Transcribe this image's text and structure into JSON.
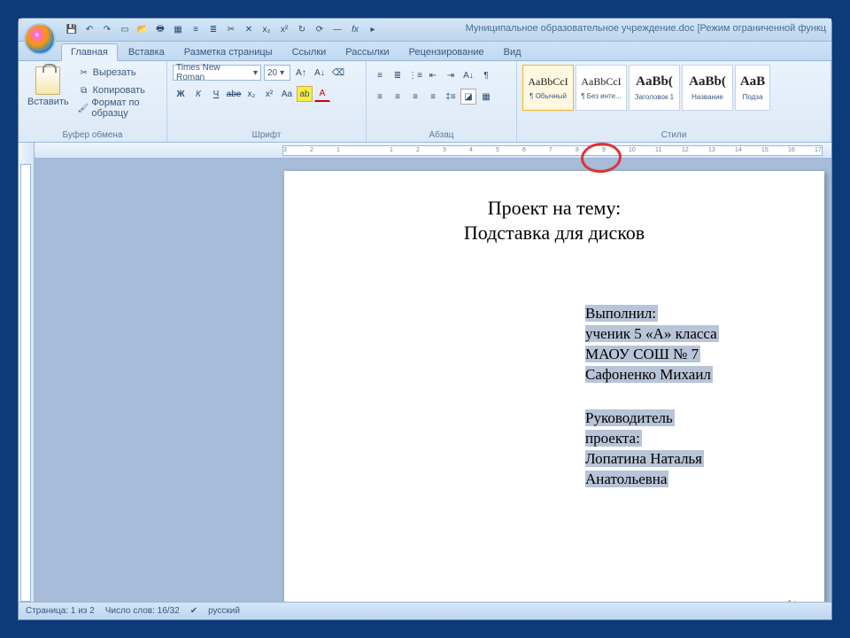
{
  "window": {
    "title": "Муниципальное образовательное учреждение.doc [Режим ограниченной функц"
  },
  "qat": [
    "save",
    "undo",
    "redo",
    "new",
    "open",
    "print",
    "table",
    "align",
    "list",
    "cut",
    "close",
    "sub",
    "sup",
    "redoA",
    "refresh",
    "minus",
    "fx",
    "play"
  ],
  "tabs": [
    {
      "label": "Главная",
      "active": true
    },
    {
      "label": "Вставка"
    },
    {
      "label": "Разметка страницы"
    },
    {
      "label": "Ссылки"
    },
    {
      "label": "Рассылки"
    },
    {
      "label": "Рецензирование"
    },
    {
      "label": "Вид"
    }
  ],
  "ribbon": {
    "clipboard": {
      "paste": "Вставить",
      "cut": "Вырезать",
      "copy": "Копировать",
      "format": "Формат по образцу",
      "title": "Буфер обмена"
    },
    "font": {
      "name": "Times New Roman",
      "size": "20",
      "title": "Шрифт",
      "btns": [
        "Ж",
        "К",
        "Ч",
        "abe",
        "x₂",
        "x²",
        "Aa",
        "ab",
        "A",
        "A"
      ]
    },
    "paragraph": {
      "title": "Абзац"
    },
    "styles": {
      "title": "Стили",
      "items": [
        {
          "preview": "AaBbCcI",
          "label": "¶ Обычный",
          "sel": true
        },
        {
          "preview": "AaBbCcI",
          "label": "¶ Без инте..."
        },
        {
          "preview": "AaBb(",
          "label": "Заголовок 1",
          "big": true
        },
        {
          "preview": "AaBb(",
          "label": "Название",
          "big": true
        },
        {
          "preview": "AaB",
          "label": "Подза",
          "big": true
        }
      ]
    }
  },
  "ruler_numbers": [
    "3",
    "2",
    "1",
    "",
    "1",
    "2",
    "3",
    "4",
    "5",
    "6",
    "7",
    "8",
    "9",
    "10",
    "11",
    "12",
    "13",
    "14",
    "15",
    "16",
    "17"
  ],
  "document": {
    "title_line1": "Проект на тему:",
    "title_line2": "Подставка для дисков",
    "block1": [
      "Выполнил:",
      "ученик 5 «А» класса",
      "МАОУ СОШ № 7",
      "Сафоненко Михаил"
    ],
    "block2": [
      "Руководитель",
      "проекта:",
      "Лопатина Наталья",
      "Анатольевна"
    ]
  },
  "status": {
    "page": "Страница: 1 из 2",
    "words": "Число слов: 16/32",
    "lang": "русский"
  }
}
